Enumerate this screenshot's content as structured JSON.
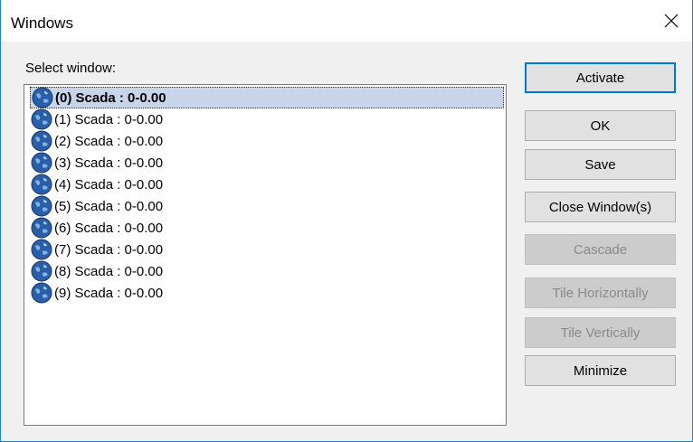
{
  "window": {
    "title": "Windows"
  },
  "list": {
    "label": "Select window:",
    "items": [
      "(0) Scada : 0-0.00",
      "(1) Scada : 0-0.00",
      "(2) Scada : 0-0.00",
      "(3) Scada : 0-0.00",
      "(4) Scada : 0-0.00",
      "(5) Scada : 0-0.00",
      "(6) Scada : 0-0.00",
      "(7) Scada : 0-0.00",
      "(8) Scada : 0-0.00",
      "(9) Scada : 0-0.00"
    ],
    "selected_index": 0,
    "item_icon": "globe-icon"
  },
  "buttons": {
    "activate": "Activate",
    "ok": "OK",
    "save": "Save",
    "close_windows": "Close Window(s)",
    "cascade": "Cascade",
    "tile_horizontally": "Tile Horizontally",
    "tile_vertically": "Tile Vertically",
    "minimize": "Minimize"
  },
  "colors": {
    "accent": "#0078d7",
    "selection": "#c7d4ea",
    "disabled_text": "#8a8a8a"
  }
}
